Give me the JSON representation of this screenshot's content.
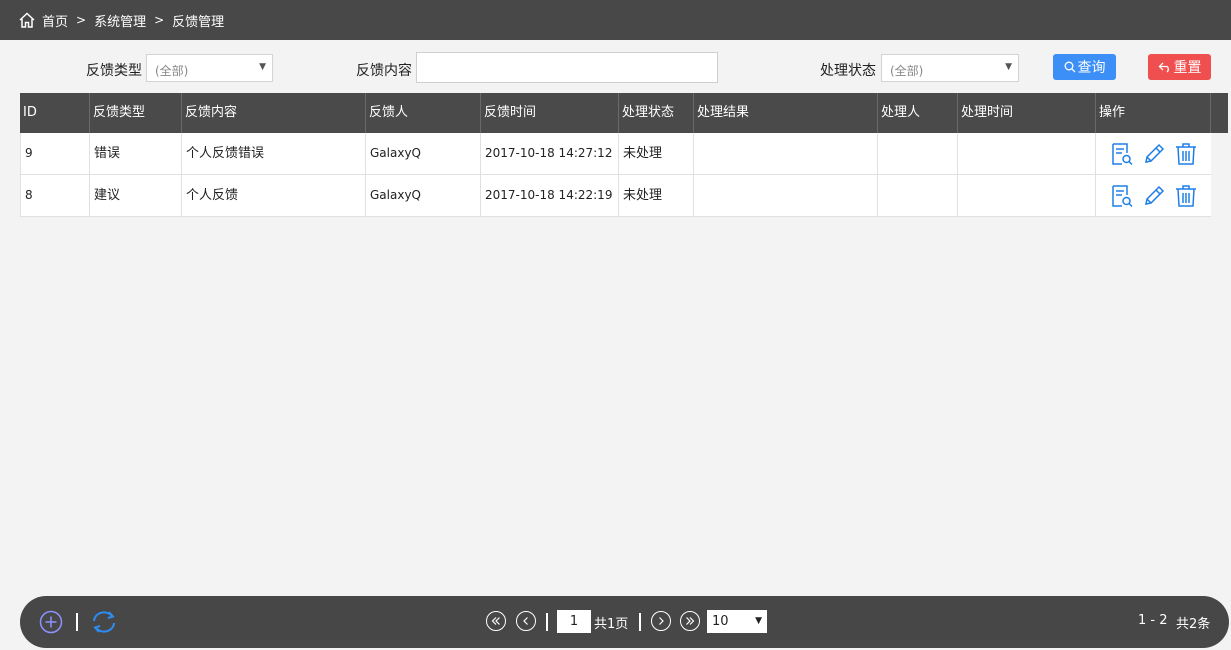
{
  "breadcrumb": {
    "items": [
      "首页",
      "系统管理",
      "反馈管理"
    ],
    "sep": ">"
  },
  "filters": {
    "type_label": "反馈类型",
    "type_value": "(全部)",
    "content_label": "反馈内容",
    "content_value": "",
    "status_label": "处理状态",
    "status_value": "(全部)",
    "query_label": "查询",
    "reset_label": "重置"
  },
  "table": {
    "columns": [
      "ID",
      "反馈类型",
      "反馈内容",
      "反馈人",
      "反馈时间",
      "处理状态",
      "处理结果",
      "处理人",
      "处理时间",
      "操作"
    ],
    "rows": [
      {
        "id": "9",
        "type": "错误",
        "content": "个人反馈错误",
        "user": "GalaxyQ",
        "time": "2017-10-18 14:27:12",
        "status": "未处理",
        "result": "",
        "handler": "",
        "handled_time": ""
      },
      {
        "id": "8",
        "type": "建议",
        "content": "个人反馈",
        "user": "GalaxyQ",
        "time": "2017-10-18 14:22:19",
        "status": "未处理",
        "result": "",
        "handler": "",
        "handled_time": ""
      }
    ]
  },
  "pager": {
    "current_page": "1",
    "total_pages_text": "共1页",
    "page_size": "10",
    "range_text": "1 - 2",
    "total_text": "共2条"
  },
  "colors": {
    "accent": "#3c8ff6",
    "danger": "#ef4f4f",
    "dark": "#484848",
    "icon_blue": "#1e7ee8"
  },
  "icons": [
    "home-icon",
    "search-icon",
    "undo-icon",
    "view-icon",
    "edit-icon",
    "delete-icon",
    "add-icon",
    "refresh-icon",
    "first-page-icon",
    "prev-page-icon",
    "next-page-icon",
    "last-page-icon"
  ]
}
